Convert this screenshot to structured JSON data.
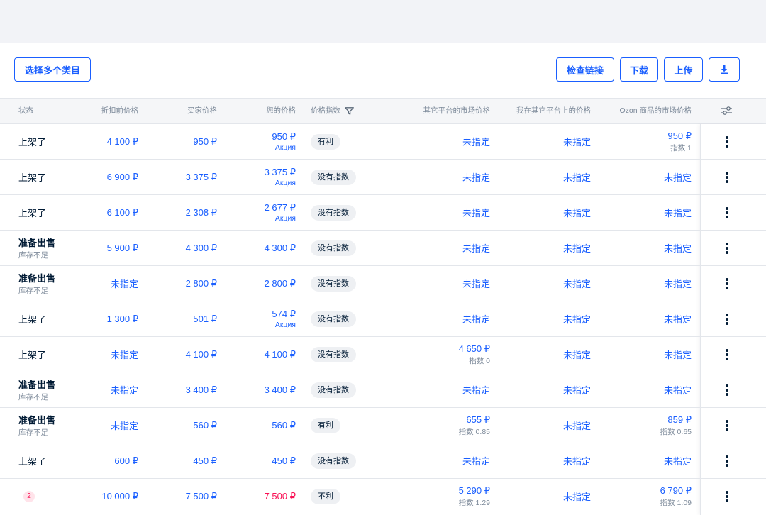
{
  "toolbar": {
    "multi_category_label": "选择多个类目",
    "check_links_label": "检查链接",
    "download_label": "下载",
    "upload_label": "上传"
  },
  "columns": {
    "status": "状态",
    "original_price": "折扣前价格",
    "buyer_price": "买家价格",
    "your_price": "您的价格",
    "price_index": "价格指数",
    "other_market_price": "其它平台的市场价格",
    "my_other_price": "我在其它平台上的价格",
    "ozon_market_price": "Ozon 商品的市场价格"
  },
  "rows": [
    {
      "status": "上架了",
      "status_sub": "",
      "original": "4 100 ₽",
      "buyer": "950 ₽",
      "yours": "950 ₽",
      "yours_sub": "Акция",
      "badge": "有利",
      "market": "未指定",
      "market_sub": "",
      "mine": "未指定",
      "ozon": "950 ₽",
      "ozon_sub": "指数 1"
    },
    {
      "status": "上架了",
      "status_sub": "",
      "original": "6 900 ₽",
      "buyer": "3 375 ₽",
      "yours": "3 375 ₽",
      "yours_sub": "Акция",
      "badge": "没有指数",
      "market": "未指定",
      "market_sub": "",
      "mine": "未指定",
      "ozon": "未指定",
      "ozon_sub": ""
    },
    {
      "status": "上架了",
      "status_sub": "",
      "original": "6 100 ₽",
      "buyer": "2 308 ₽",
      "yours": "2 677 ₽",
      "yours_sub": "Акция",
      "badge": "没有指数",
      "market": "未指定",
      "market_sub": "",
      "mine": "未指定",
      "ozon": "未指定",
      "ozon_sub": ""
    },
    {
      "status": "准备出售",
      "status_sub": "库存不足",
      "original": "5 900 ₽",
      "buyer": "4 300 ₽",
      "yours": "4 300 ₽",
      "yours_sub": "",
      "badge": "没有指数",
      "market": "未指定",
      "market_sub": "",
      "mine": "未指定",
      "ozon": "未指定",
      "ozon_sub": ""
    },
    {
      "status": "准备出售",
      "status_sub": "库存不足",
      "original": "未指定",
      "buyer": "2 800 ₽",
      "yours": "2 800 ₽",
      "yours_sub": "",
      "badge": "没有指数",
      "market": "未指定",
      "market_sub": "",
      "mine": "未指定",
      "ozon": "未指定",
      "ozon_sub": ""
    },
    {
      "status": "上架了",
      "status_sub": "",
      "original": "1 300 ₽",
      "buyer": "501 ₽",
      "yours": "574 ₽",
      "yours_sub": "Акция",
      "badge": "没有指数",
      "market": "未指定",
      "market_sub": "",
      "mine": "未指定",
      "ozon": "未指定",
      "ozon_sub": ""
    },
    {
      "status": "上架了",
      "status_sub": "",
      "original": "未指定",
      "buyer": "4 100 ₽",
      "yours": "4 100 ₽",
      "yours_sub": "",
      "badge": "没有指数",
      "market": "4 650 ₽",
      "market_sub": "指数 0",
      "mine": "未指定",
      "ozon": "未指定",
      "ozon_sub": ""
    },
    {
      "status": "准备出售",
      "status_sub": "库存不足",
      "original": "未指定",
      "buyer": "3 400 ₽",
      "yours": "3 400 ₽",
      "yours_sub": "",
      "badge": "没有指数",
      "market": "未指定",
      "market_sub": "",
      "mine": "未指定",
      "ozon": "未指定",
      "ozon_sub": ""
    },
    {
      "status": "准备出售",
      "status_sub": "库存不足",
      "original": "未指定",
      "buyer": "560 ₽",
      "yours": "560 ₽",
      "yours_sub": "",
      "badge": "有利",
      "market": "655 ₽",
      "market_sub": "指数 0.85",
      "mine": "未指定",
      "ozon": "859 ₽",
      "ozon_sub": "指数 0.65"
    },
    {
      "status": "上架了",
      "status_sub": "",
      "original": "600 ₽",
      "buyer": "450 ₽",
      "yours": "450 ₽",
      "yours_sub": "",
      "badge": "没有指数",
      "market": "未指定",
      "market_sub": "",
      "mine": "未指定",
      "ozon": "未指定",
      "ozon_sub": ""
    },
    {
      "status": "",
      "status_sub": "",
      "status_count": "2",
      "original": "10 000 ₽",
      "buyer": "7 500 ₽",
      "yours": "7 500 ₽",
      "yours_sub": "",
      "yours_red": true,
      "badge": "不利",
      "market": "5 290 ₽",
      "market_sub": "指数 1.29",
      "mine": "未指定",
      "ozon": "6 790 ₽",
      "ozon_sub": "指数 1.09"
    }
  ],
  "colors": {
    "accent": "#1a5fff",
    "text": "#001a34",
    "muted": "#7d8a9a",
    "danger": "#f91155"
  }
}
